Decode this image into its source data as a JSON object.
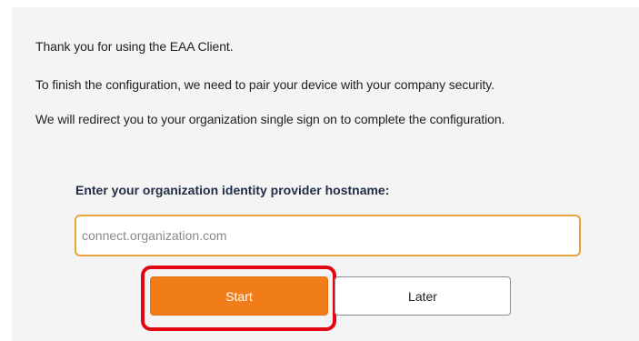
{
  "intro": {
    "line1": "Thank you for using the EAA Client.",
    "line2": "To finish the configuration, we need to pair your device with your company security.",
    "line3": "We will redirect you to your organization single sign on to complete the configuration."
  },
  "form": {
    "label": "Enter your organization identity provider hostname:",
    "hostname_value": "",
    "hostname_placeholder": "connect.organization.com"
  },
  "buttons": {
    "start_label": "Start",
    "later_label": "Later"
  },
  "colors": {
    "panel_background": "#f4f4f4",
    "accent_orange": "#f07d18",
    "input_border": "#e8a33a",
    "highlight_red": "#e30613"
  }
}
